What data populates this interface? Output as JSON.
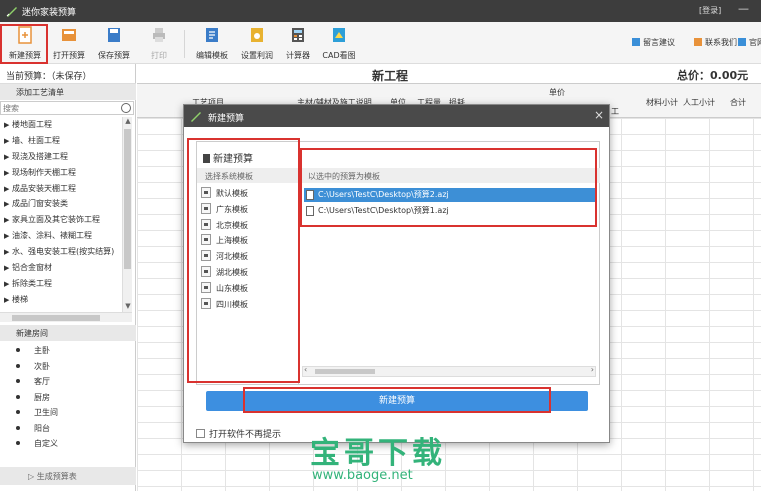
{
  "app": {
    "title": "迷你家装预算",
    "login": "[登录]",
    "minimize": "—"
  },
  "toolbar": {
    "buttons": [
      {
        "label": "新建预算",
        "icon": "new-budget-icon",
        "color": "#e8923a"
      },
      {
        "label": "打开预算",
        "icon": "open-folder-icon",
        "color": "#e8923a"
      },
      {
        "label": "保存预算",
        "icon": "save-disk-icon",
        "color": "#3a7cc8"
      },
      {
        "label": "打印",
        "icon": "printer-icon",
        "color": "#bbbbbb"
      },
      {
        "label": "编辑模板",
        "icon": "edit-template-icon",
        "color": "#3a7cc8"
      },
      {
        "label": "设置利润",
        "icon": "profit-settings-icon",
        "color": "#e8b230"
      },
      {
        "label": "计算器",
        "icon": "calculator-icon",
        "color": "#3a7cc8"
      },
      {
        "label": "CAD看图",
        "icon": "cad-viewer-icon",
        "color": "#2d9fd8"
      }
    ],
    "right": [
      {
        "label": "留言建议",
        "icon": "message-icon",
        "color": "#3a8fd8"
      },
      {
        "label": "联系我们",
        "icon": "contact-icon",
        "color": "#e8923a"
      },
      {
        "label": "官网",
        "icon": "website-icon",
        "color": "#3a8fd8"
      }
    ]
  },
  "left": {
    "current_budget": "当前预算：（未保存）",
    "craft_title": "添加工艺清单",
    "search_placeholder": "搜索",
    "crafts": [
      "楼地面工程",
      "墙、柱面工程",
      "现浇及搭建工程",
      "现场制作天棚工程",
      "成品安装天棚工程",
      "成品门窗安装类",
      "家具立面及其它装饰工程",
      "油漆、涂料、裱糊工程",
      "水、强电安装工程(按实结算)",
      "铝合金窗材",
      "拆除类工程",
      "楼梯"
    ],
    "room_title": "新建房间",
    "rooms": [
      "主卧",
      "次卧",
      "客厅",
      "厨房",
      "卫生间",
      "阳台",
      "自定义"
    ],
    "generate": "▷ 生成预算表"
  },
  "main": {
    "project_name": "新工程",
    "total": "总价：0.00元",
    "headers": {
      "craft": "工艺项目",
      "material": "主材/辅材及施工说明",
      "unit": "单位",
      "quantity": "工程量",
      "loss": "损耗",
      "unit_price": "单价",
      "labor_partial": "工",
      "material_subtotal": "材料小计",
      "labor_subtotal": "人工小计",
      "total_col": "合计"
    }
  },
  "dialog": {
    "title": "新建预算",
    "close": "×",
    "left_heading": "新建预算",
    "system_templates_label": "选择系统模板",
    "templates": [
      "默认模板",
      "广东模板",
      "北京模板",
      "上海模板",
      "河北模板",
      "湖北模板",
      "山东模板",
      "四川模板"
    ],
    "right_heading": "以选中的预算为模板",
    "files": [
      {
        "path": "C:\\Users\\TestC\\Desktop\\预算2.azj",
        "selected": true
      },
      {
        "path": "C:\\Users\\TestC\\Desktop\\预算1.azj",
        "selected": false
      }
    ],
    "create_button": "新建预算",
    "no_prompt": "打开软件不再提示"
  },
  "watermark": {
    "text": "宝哥下载",
    "url": "www.baoge.net"
  },
  "colors": {
    "highlight": "#d9322f",
    "accent": "#3d8fe0",
    "titlebar": "#3d3d3d"
  }
}
